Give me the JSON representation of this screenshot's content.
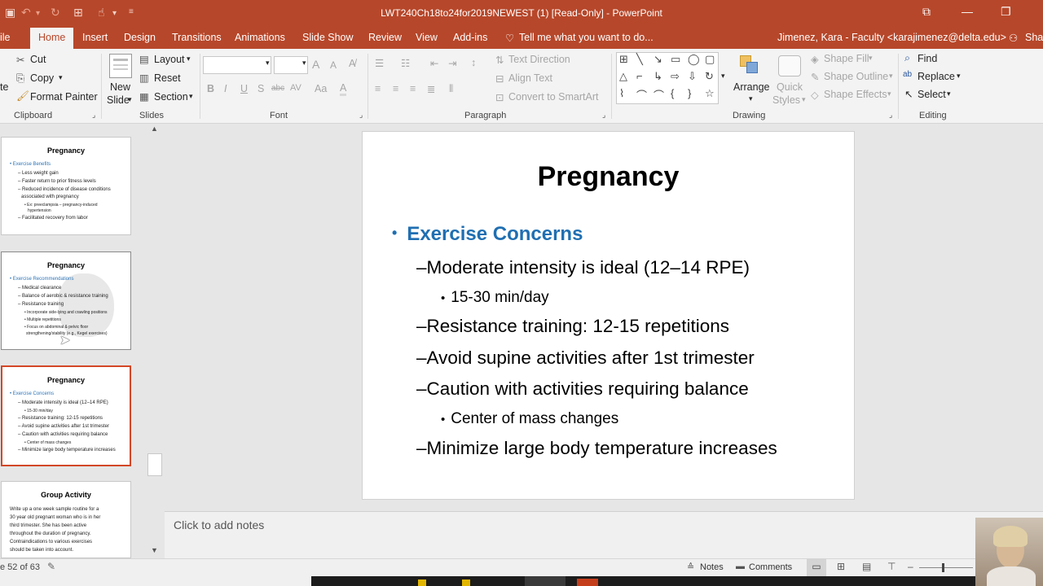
{
  "window": {
    "title": "LWT240Ch18to24for2019NEWEST (1) [Read-Only] - PowerPoint",
    "share_label": "Sha"
  },
  "tabs": [
    {
      "label": "ile"
    },
    {
      "label": "Home"
    },
    {
      "label": "Insert"
    },
    {
      "label": "Design"
    },
    {
      "label": "Transitions"
    },
    {
      "label": "Animations"
    },
    {
      "label": "Slide Show"
    },
    {
      "label": "Review"
    },
    {
      "label": "View"
    },
    {
      "label": "Add-ins"
    }
  ],
  "tell_me": "Tell me what you want to do...",
  "account": "Jimenez, Kara - Faculty <karajimenez@delta.edu>",
  "ribbon": {
    "clipboard": {
      "cut": "Cut",
      "copy": "Copy",
      "format_painter": "Format Painter",
      "paste_fragment": "te",
      "label": "Clipboard"
    },
    "slides": {
      "new_slide_1": "New",
      "new_slide_2": "Slide",
      "layout": "Layout",
      "reset": "Reset",
      "section": "Section",
      "label": "Slides"
    },
    "font": {
      "label": "Font",
      "bold": "B",
      "italic": "I",
      "underline": "U",
      "shadow": "S",
      "strike": "abc",
      "spacing": "AV",
      "case": "Aa",
      "grow": "A",
      "shrink": "A"
    },
    "paragraph": {
      "text_direction": "Text Direction",
      "align_text": "Align Text",
      "convert_smartart": "Convert to SmartArt",
      "label": "Paragraph"
    },
    "drawing": {
      "arrange": "Arrange",
      "quick_styles_1": "Quick",
      "quick_styles_2": "Styles",
      "shape_fill": "Shape Fill",
      "shape_outline": "Shape Outline",
      "shape_effects": "Shape Effects",
      "label": "Drawing"
    },
    "editing": {
      "find": "Find",
      "replace": "Replace",
      "select": "Select",
      "label": "Editing"
    }
  },
  "thumbnails": [
    {
      "title": "Pregnancy",
      "lines": [
        {
          "t": "• Exercise Benefits",
          "blue": true,
          "indent": 0
        },
        {
          "t": "– Less weight gain",
          "indent": 1
        },
        {
          "t": "– Faster return to prior fitness levels",
          "indent": 1
        },
        {
          "t": "– Reduced incidence of disease conditions",
          "indent": 1
        },
        {
          "t": "associated with pregnancy",
          "indent": 2
        },
        {
          "t": "• Ex: preeclampsia – pregnancy-induced",
          "indent": 3
        },
        {
          "t": "hypertension",
          "indent": 4
        },
        {
          "t": "– Facilitated recovery from labor",
          "indent": 1
        }
      ]
    },
    {
      "title": "Pregnancy",
      "lines": [
        {
          "t": "• Exercise Recommendations",
          "blue": true,
          "indent": 0
        },
        {
          "t": "– Medical clearance",
          "indent": 1
        },
        {
          "t": "– Balance of aerobic & resistance training",
          "indent": 1
        },
        {
          "t": "– Resistance training",
          "indent": 1
        },
        {
          "t": "• Incorporate side-lying and crawling positions",
          "indent": 3
        },
        {
          "t": "• Multiple repetitions",
          "indent": 3
        },
        {
          "t": "• Focus on abdominal & pelvic floor",
          "indent": 3
        },
        {
          "t": "strengthening/stability (e.g., Kegel exercises)",
          "indent": 4
        }
      ]
    },
    {
      "title": "Pregnancy",
      "lines": [
        {
          "t": "• Exercise Concerns",
          "blue": true,
          "indent": 0
        },
        {
          "t": "– Moderate intensity is ideal (12–14 RPE)",
          "indent": 1
        },
        {
          "t": "• 15-30 min/day",
          "indent": 3
        },
        {
          "t": "– Resistance training: 12-15 repetitions",
          "indent": 1
        },
        {
          "t": "– Avoid supine activities after 1st trimester",
          "indent": 1
        },
        {
          "t": "– Caution with activities requiring balance",
          "indent": 1
        },
        {
          "t": "• Center of mass changes",
          "indent": 3
        },
        {
          "t": "– Minimize large body temperature increases",
          "indent": 1
        }
      ]
    },
    {
      "title": "Group Activity",
      "lines": [
        {
          "t": "Write up a one week sample routine for a",
          "indent": 0
        },
        {
          "t": "30 year old pregnant woman who is in her",
          "indent": 0
        },
        {
          "t": "third trimester.  She has been active",
          "indent": 0
        },
        {
          "t": "throughout the duration of pregnancy.",
          "indent": 0
        },
        {
          "t": "Contraindications to various exercises",
          "indent": 0
        },
        {
          "t": "should be taken into account.",
          "indent": 0
        }
      ]
    }
  ],
  "slide": {
    "title": "Pregnancy",
    "heading": "Exercise Concerns",
    "items": [
      {
        "level": 2,
        "text": "Moderate intensity is ideal (12–14 RPE)"
      },
      {
        "level": 3,
        "text": "15-30 min/day"
      },
      {
        "level": 2,
        "text": "Resistance training: 12-15 repetitions"
      },
      {
        "level": 2,
        "text": "Avoid supine activities after 1st trimester"
      },
      {
        "level": 2,
        "text": "Caution with activities requiring balance"
      },
      {
        "level": 3,
        "text": "Center of mass changes"
      },
      {
        "level": 2,
        "text": "Minimize large body temperature increases"
      }
    ]
  },
  "notes_placeholder": "Click to add notes",
  "status": {
    "slide_counter": "e 52 of 63",
    "notes": "Notes",
    "comments": "Comments"
  },
  "colors": {
    "accent": "#b7472a",
    "heading_blue": "#1f6fb2",
    "selected_border": "#d24726"
  }
}
